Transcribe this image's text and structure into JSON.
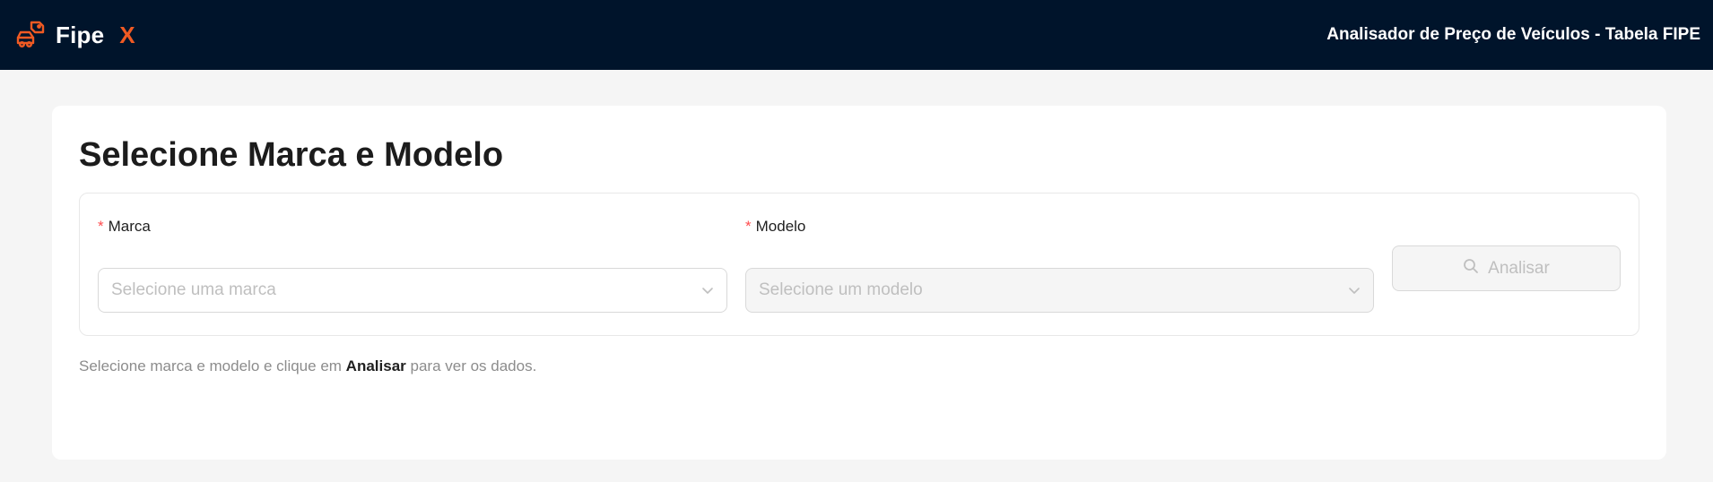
{
  "header": {
    "brand_name": "Fipe",
    "brand_suffix": "X",
    "title": "Analisador de Preço de Veículos - Tabela FIPE",
    "brand_icon": "car-tag-icon",
    "brand_color": "#f05a23",
    "bg_color": "#00142b"
  },
  "main": {
    "title": "Selecione Marca e Modelo",
    "form": {
      "marca": {
        "required_mark": "*",
        "label": "Marca",
        "placeholder": "Selecione uma marca",
        "disabled": false
      },
      "modelo": {
        "required_mark": "*",
        "label": "Modelo",
        "placeholder": "Selecione um modelo",
        "disabled": true
      },
      "analyze_button": {
        "label": "Analisar",
        "icon": "search-icon",
        "disabled": true
      }
    },
    "hint": {
      "before": "Selecione marca e modelo e clique em",
      "bold": "Analisar",
      "after": "para ver os dados."
    }
  }
}
